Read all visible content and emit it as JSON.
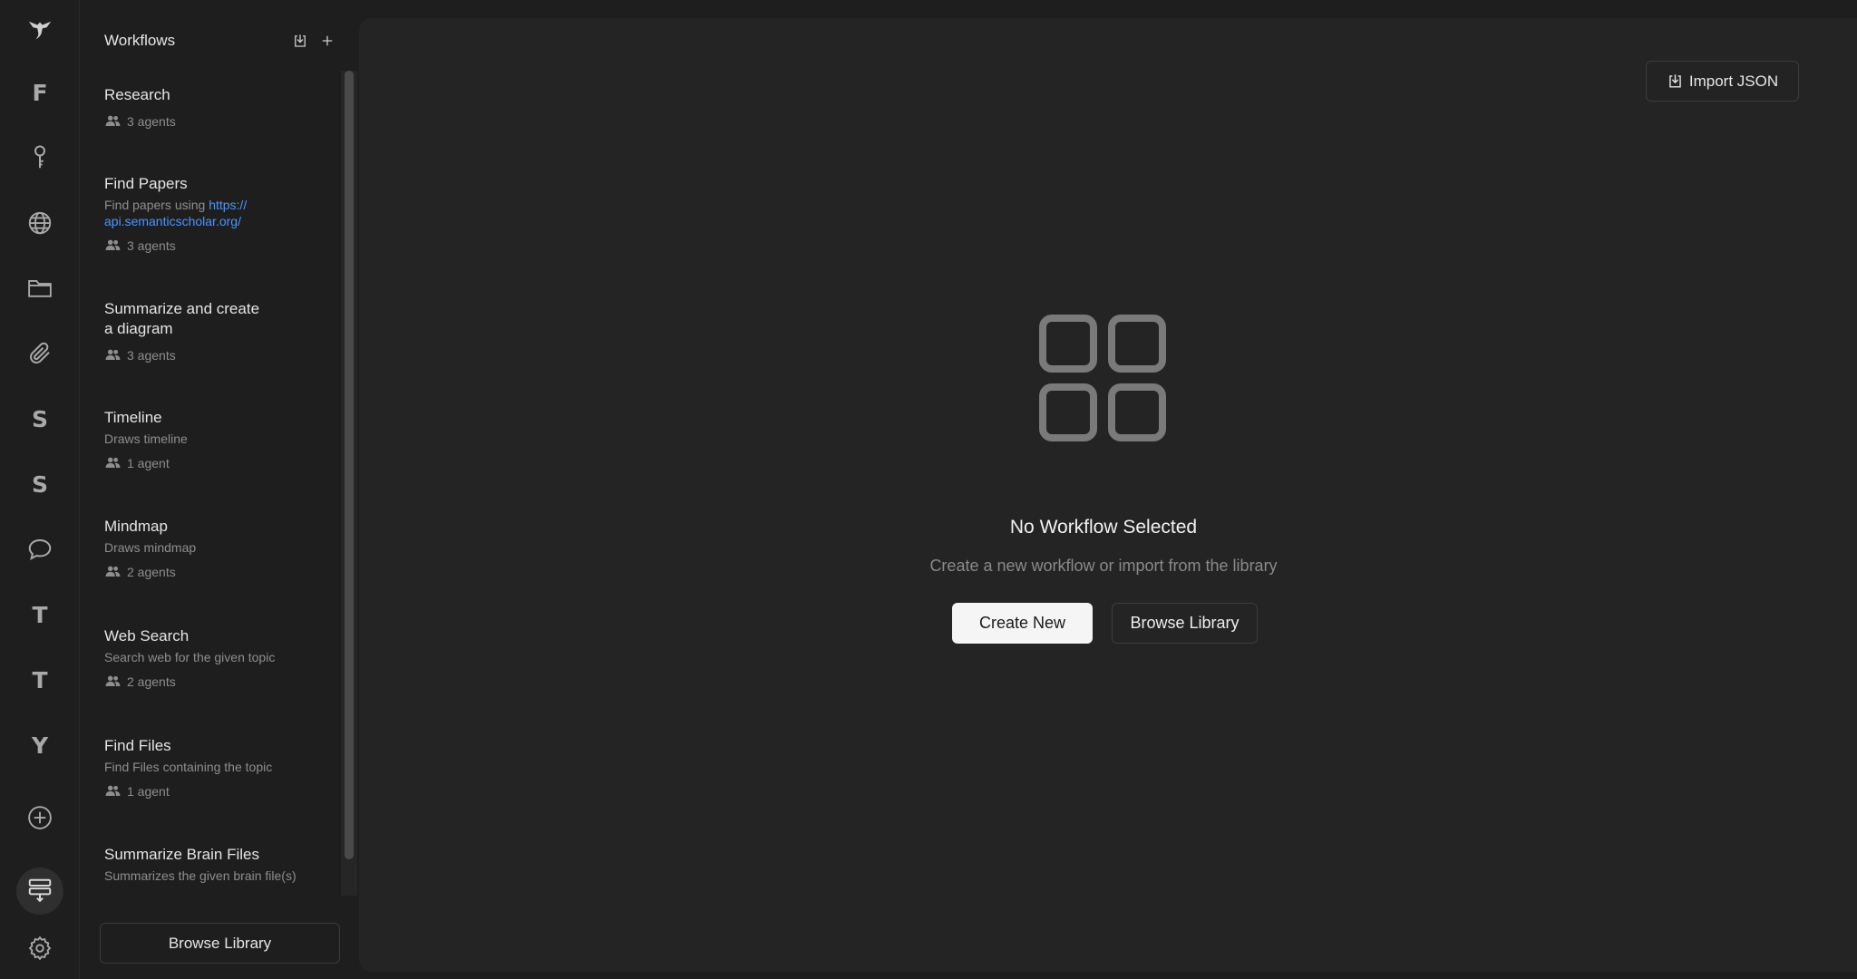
{
  "rail": {
    "items": [
      {
        "name": "logo",
        "icon": "bird-logo-icon"
      },
      {
        "name": "F",
        "letter": "F"
      },
      {
        "name": "keys",
        "icon": "key-icon"
      },
      {
        "name": "web",
        "icon": "globe-icon"
      },
      {
        "name": "files",
        "icon": "folder-icon"
      },
      {
        "name": "attachments",
        "icon": "paperclip-icon"
      },
      {
        "name": "S1",
        "letter": "S"
      },
      {
        "name": "S2",
        "letter": "S"
      },
      {
        "name": "chat",
        "icon": "chat-bubble-icon"
      },
      {
        "name": "T1",
        "letter": "T"
      },
      {
        "name": "T2",
        "letter": "T"
      },
      {
        "name": "Y",
        "letter": "Y"
      },
      {
        "name": "add",
        "icon": "plus-circle-icon"
      },
      {
        "name": "workflows",
        "icon": "workflow-stack-icon",
        "active": true
      },
      {
        "name": "settings",
        "icon": "gear-icon"
      }
    ]
  },
  "sidebar": {
    "title": "Workflows",
    "import_icon": "import-icon",
    "add_icon": "plus-icon",
    "workflows": [
      {
        "title": "Research",
        "desc": "",
        "agents": "3 agents"
      },
      {
        "title": "Find Papers",
        "desc_prefix": "Find papers using ",
        "desc_link": "https://\napi.semanticscholar.org/",
        "agents": "3 agents"
      },
      {
        "title": "Summarize and create\na diagram",
        "desc": "",
        "agents": "3 agents"
      },
      {
        "title": "Timeline",
        "desc": "Draws timeline",
        "agents": "1 agent"
      },
      {
        "title": "Mindmap",
        "desc": "Draws mindmap",
        "agents": "2 agents"
      },
      {
        "title": "Web Search",
        "desc": "Search web for the given topic",
        "agents": "2 agents"
      },
      {
        "title": "Find Files",
        "desc": "Find Files containing the topic",
        "agents": "1 agent"
      },
      {
        "title": "Summarize Brain Files",
        "desc": "Summarizes the given brain file(s)",
        "agents": ""
      }
    ],
    "browse_label": "Browse Library"
  },
  "main": {
    "import_label": "Import JSON",
    "empty_title": "No Workflow Selected",
    "empty_subtitle": "Create a new workflow or import from the library",
    "create_label": "Create New",
    "browse_label": "Browse Library"
  },
  "colors": {
    "background": "#1e1e1e",
    "panel": "#242424",
    "link": "#4d94ff",
    "primary_button": "#f5f5f5"
  }
}
